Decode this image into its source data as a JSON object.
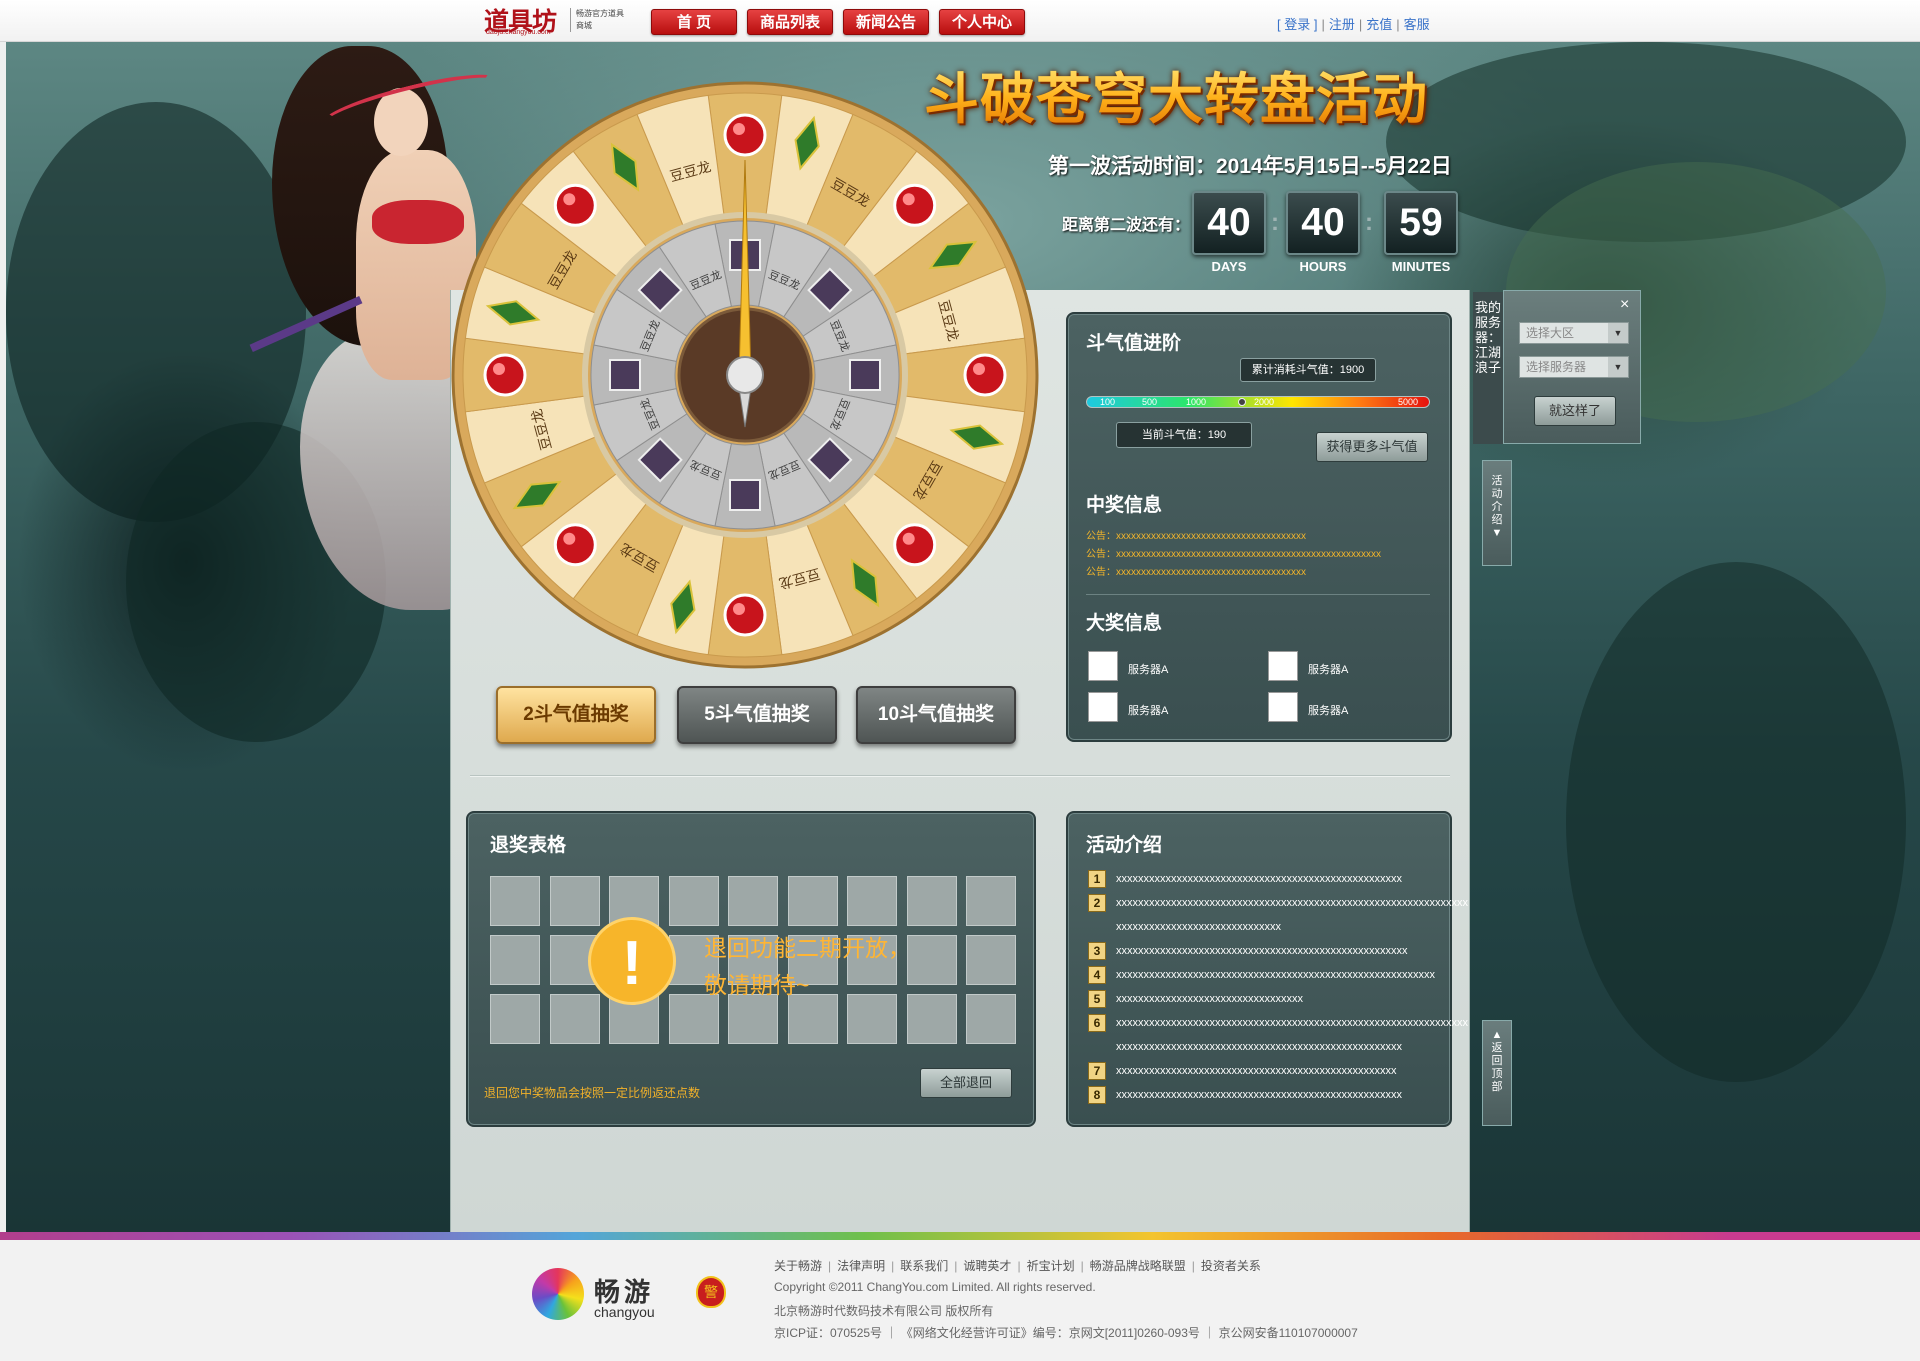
{
  "header": {
    "logo_text": "道具坊",
    "logo_url": "daoju.changyou.com",
    "logo_sub": "畅游官方道具商城",
    "nav": [
      "首 页",
      "商品列表",
      "新闻公告",
      "个人中心"
    ],
    "links": {
      "login": "[ 登录 ]",
      "register": "注册",
      "recharge": "充值",
      "service": "客服"
    }
  },
  "event": {
    "title": "斗破苍穹大转盘活动",
    "time": "第一波活动时间：2014年5月15日--5月22日",
    "countdown_label": "距离第二波还有：",
    "countdown": [
      {
        "value": "40",
        "unit": "DAYS"
      },
      {
        "value": "40",
        "unit": "HOURS"
      },
      {
        "value": "59",
        "unit": "MINUTES"
      }
    ]
  },
  "wheel": {
    "outer_label": "豆豆龙",
    "inner_label": "豆豆龙",
    "outer_segments": 24,
    "inner_segments": 16,
    "colors": {
      "cream": "#f6e3b8",
      "gold": "#e2ba6a",
      "rim": "#d9a95c",
      "inner": "#b9b9b9",
      "hub": "#5a3a26"
    }
  },
  "draw_buttons": {
    "draw2": "2斗气值抽奖",
    "draw5": "5斗气值抽奖",
    "draw10": "10斗气值抽奖"
  },
  "power": {
    "title": "斗气值进阶",
    "total": "累计消耗斗气值：1900",
    "current": "当前斗气值：190",
    "ticks": [
      "100",
      "500",
      "1000",
      "2000",
      "5000"
    ],
    "get_more": "获得更多斗气值"
  },
  "prize": {
    "title": "中奖信息",
    "notices": [
      {
        "prefix": "公告：",
        "text": "xxxxxxxxxxxxxxxxxxxxxxxxxxxxxxxxxxxxxx"
      },
      {
        "prefix": "公告：",
        "text": "xxxxxxxxxxxxxxxxxxxxxxxxxxxxxxxxxxxxxxxxxxxxxxxxxxxxx"
      },
      {
        "prefix": "公告：",
        "text": "xxxxxxxxxxxxxxxxxxxxxxxxxxxxxxxxxxxxxx"
      }
    ]
  },
  "grand": {
    "title": "大奖信息",
    "servers": [
      "服务器A",
      "服务器A",
      "服务器A",
      "服务器A"
    ]
  },
  "server": {
    "tab_label": "我的服务器：江湖浪子",
    "select_area": "选择大区",
    "select_server": "选择服务器",
    "confirm": "就这样了",
    "close": "×"
  },
  "side": {
    "intro": "活动介绍",
    "backtop": "返回顶部"
  },
  "refund": {
    "title": "退奖表格",
    "message_line1": "退回功能二期开放，",
    "message_line2": "敬请期待~",
    "warn_glyph": "!",
    "note": "退回您中奖物品会按照一定比例返还点数",
    "button": "全部退回"
  },
  "intro": {
    "title": "活动介绍",
    "items": [
      {
        "num": "1",
        "lines": [
          "xxxxxxxxxxxxxxxxxxxxxxxxxxxxxxxxxxxxxxxxxxxxxxxxxxxx"
        ]
      },
      {
        "num": "2",
        "lines": [
          "xxxxxxxxxxxxxxxxxxxxxxxxxxxxxxxxxxxxxxxxxxxxxxxxxxxxxxxxxxxxxxxx",
          "xxxxxxxxxxxxxxxxxxxxxxxxxxxxxx"
        ]
      },
      {
        "num": "3",
        "lines": [
          "xxxxxxxxxxxxxxxxxxxxxxxxxxxxxxxxxxxxxxxxxxxxxxxxxxxxx"
        ]
      },
      {
        "num": "4",
        "lines": [
          "xxxxxxxxxxxxxxxxxxxxxxxxxxxxxxxxxxxxxxxxxxxxxxxxxxxxxxxxxx"
        ]
      },
      {
        "num": "5",
        "lines": [
          "xxxxxxxxxxxxxxxxxxxxxxxxxxxxxxxxxx"
        ]
      },
      {
        "num": "6",
        "lines": [
          "xxxxxxxxxxxxxxxxxxxxxxxxxxxxxxxxxxxxxxxxxxxxxxxxxxxxxxxxxxxxxxxx",
          "xxxxxxxxxxxxxxxxxxxxxxxxxxxxxxxxxxxxxxxxxxxxxxxxxxxx"
        ]
      },
      {
        "num": "7",
        "lines": [
          "xxxxxxxxxxxxxxxxxxxxxxxxxxxxxxxxxxxxxxxxxxxxxxxxxxx"
        ]
      },
      {
        "num": "8",
        "lines": [
          "xxxxxxxxxxxxxxxxxxxxxxxxxxxxxxxxxxxxxxxxxxxxxxxxxxxx"
        ]
      }
    ]
  },
  "footer": {
    "brand_cn": "畅游",
    "brand_en": "changyou",
    "police_glyph": "警",
    "links": [
      "关于畅游",
      "法律声明",
      "联系我们",
      "诚聘英才",
      "祈宝计划",
      "畅游品牌战略联盟",
      "投资者关系"
    ],
    "copyright": "Copyright ©2011 ChangYou.com Limited. All rights reserved.",
    "company": "北京畅游时代数码技术有限公司 版权所有",
    "icp": "京ICP证：070525号 ｜ 《网络文化经营许可证》编号：京网文[2011]0260-093号 ｜ 京公网安备110107000007"
  }
}
